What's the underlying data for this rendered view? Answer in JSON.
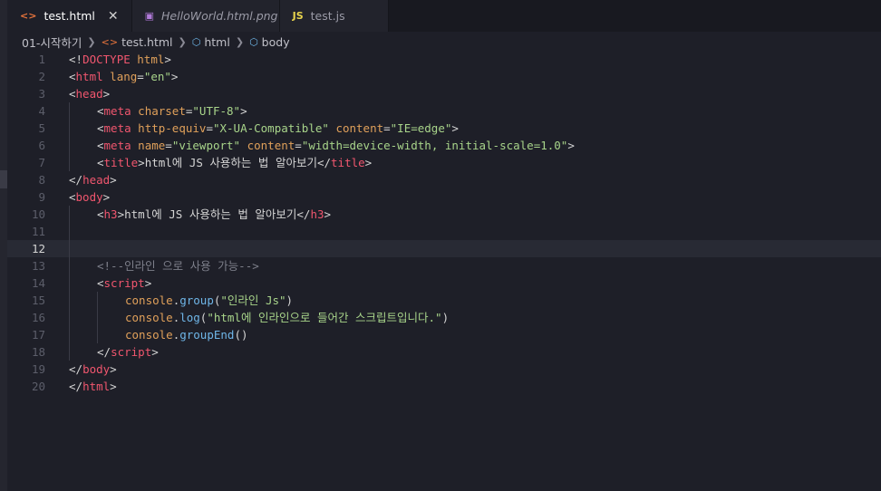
{
  "tabs": [
    {
      "icon": "<>",
      "label": "test.html",
      "active": true,
      "close": "✕"
    },
    {
      "icon": "▣",
      "label": "HelloWorld.html.png",
      "active": false
    },
    {
      "icon": "JS",
      "label": "test.js",
      "active": false
    }
  ],
  "breadcrumb": {
    "folder": "01-시작하기",
    "file": "test.html",
    "node1": "html",
    "node2": "body"
  },
  "colors": {
    "tag": "#f0566e",
    "attr": "#e0a05a",
    "string": "#a8d48a",
    "comment": "#7d7f8a",
    "function": "#6fb6e8"
  },
  "current_line": 12,
  "lines": [
    {
      "n": "1",
      "indent": 0,
      "tokens": [
        [
          "p",
          "<!"
        ],
        [
          "t",
          "DOCTYPE"
        ],
        [
          "p",
          " "
        ],
        [
          "a",
          "html"
        ],
        [
          "p",
          ">"
        ]
      ]
    },
    {
      "n": "2",
      "indent": 0,
      "tokens": [
        [
          "p",
          "<"
        ],
        [
          "t",
          "html"
        ],
        [
          "p",
          " "
        ],
        [
          "a",
          "lang"
        ],
        [
          "p",
          "="
        ],
        [
          "s",
          "\"en\""
        ],
        [
          "p",
          ">"
        ]
      ]
    },
    {
      "n": "3",
      "indent": 0,
      "tokens": [
        [
          "p",
          "<"
        ],
        [
          "t",
          "head"
        ],
        [
          "p",
          ">"
        ]
      ]
    },
    {
      "n": "4",
      "indent": 1,
      "tokens": [
        [
          "p",
          "<"
        ],
        [
          "t",
          "meta"
        ],
        [
          "p",
          " "
        ],
        [
          "a",
          "charset"
        ],
        [
          "p",
          "="
        ],
        [
          "s",
          "\"UTF-8\""
        ],
        [
          "p",
          ">"
        ]
      ]
    },
    {
      "n": "5",
      "indent": 1,
      "tokens": [
        [
          "p",
          "<"
        ],
        [
          "t",
          "meta"
        ],
        [
          "p",
          " "
        ],
        [
          "a",
          "http-equiv"
        ],
        [
          "p",
          "="
        ],
        [
          "s",
          "\"X-UA-Compatible\""
        ],
        [
          "p",
          " "
        ],
        [
          "a",
          "content"
        ],
        [
          "p",
          "="
        ],
        [
          "s",
          "\"IE=edge\""
        ],
        [
          "p",
          ">"
        ]
      ]
    },
    {
      "n": "6",
      "indent": 1,
      "tokens": [
        [
          "p",
          "<"
        ],
        [
          "t",
          "meta"
        ],
        [
          "p",
          " "
        ],
        [
          "a",
          "name"
        ],
        [
          "p",
          "="
        ],
        [
          "s",
          "\"viewport\""
        ],
        [
          "p",
          " "
        ],
        [
          "a",
          "content"
        ],
        [
          "p",
          "="
        ],
        [
          "s",
          "\"width=device-width, initial-scale=1.0\""
        ],
        [
          "p",
          ">"
        ]
      ]
    },
    {
      "n": "7",
      "indent": 1,
      "tokens": [
        [
          "p",
          "<"
        ],
        [
          "t",
          "title"
        ],
        [
          "p",
          ">"
        ],
        [
          "tx",
          "html에 JS 사용하는 법 알아보기"
        ],
        [
          "p",
          "</"
        ],
        [
          "t",
          "title"
        ],
        [
          "p",
          ">"
        ]
      ]
    },
    {
      "n": "8",
      "indent": 0,
      "tokens": [
        [
          "p",
          "</"
        ],
        [
          "t",
          "head"
        ],
        [
          "p",
          ">"
        ]
      ]
    },
    {
      "n": "9",
      "indent": 0,
      "tokens": [
        [
          "p",
          "<"
        ],
        [
          "t",
          "body"
        ],
        [
          "p",
          ">"
        ]
      ]
    },
    {
      "n": "10",
      "indent": 1,
      "tokens": [
        [
          "p",
          "<"
        ],
        [
          "t",
          "h3"
        ],
        [
          "p",
          ">"
        ],
        [
          "tx",
          "html에 JS 사용하는 법 알아보기"
        ],
        [
          "p",
          "</"
        ],
        [
          "t",
          "h3"
        ],
        [
          "p",
          ">"
        ]
      ]
    },
    {
      "n": "11",
      "indent": 1,
      "tokens": []
    },
    {
      "n": "12",
      "indent": 1,
      "tokens": []
    },
    {
      "n": "13",
      "indent": 1,
      "tokens": [
        [
          "c",
          "<!--인라인 으로 사용 가능-->"
        ]
      ]
    },
    {
      "n": "14",
      "indent": 1,
      "tokens": [
        [
          "p",
          "<"
        ],
        [
          "t",
          "script"
        ],
        [
          "p",
          ">"
        ]
      ]
    },
    {
      "n": "15",
      "indent": 2,
      "tokens": [
        [
          "v",
          "console"
        ],
        [
          "p",
          "."
        ],
        [
          "f",
          "group"
        ],
        [
          "p",
          "("
        ],
        [
          "s",
          "\"인라인 Js\""
        ],
        [
          "p",
          ")"
        ]
      ]
    },
    {
      "n": "16",
      "indent": 2,
      "tokens": [
        [
          "v",
          "console"
        ],
        [
          "p",
          "."
        ],
        [
          "f",
          "log"
        ],
        [
          "p",
          "("
        ],
        [
          "s",
          "\"html에 인라인으로 들어간 스크립트입니다.\""
        ],
        [
          "p",
          ")"
        ]
      ]
    },
    {
      "n": "17",
      "indent": 2,
      "tokens": [
        [
          "v",
          "console"
        ],
        [
          "p",
          "."
        ],
        [
          "f",
          "groupEnd"
        ],
        [
          "p",
          "()"
        ]
      ]
    },
    {
      "n": "18",
      "indent": 1,
      "tokens": [
        [
          "p",
          "</"
        ],
        [
          "t",
          "script"
        ],
        [
          "p",
          ">"
        ]
      ]
    },
    {
      "n": "19",
      "indent": 0,
      "tokens": [
        [
          "p",
          "</"
        ],
        [
          "t",
          "body"
        ],
        [
          "p",
          ">"
        ]
      ]
    },
    {
      "n": "20",
      "indent": 0,
      "tokens": [
        [
          "p",
          "</"
        ],
        [
          "t",
          "html"
        ],
        [
          "p",
          ">"
        ]
      ]
    }
  ]
}
